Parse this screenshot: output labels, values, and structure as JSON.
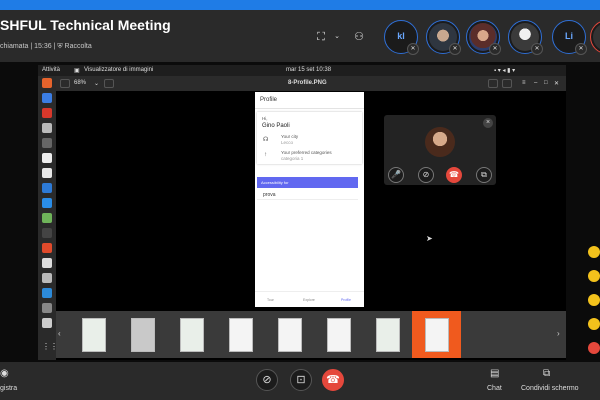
{
  "header": {
    "title": "SHFUL Technical Meeting",
    "subtitle": "chiamata | 15:36 | ⛨ Raccolta",
    "participants": [
      {
        "initials": "kl"
      },
      {
        "initials": ""
      },
      {
        "initials": ""
      },
      {
        "initials": ""
      },
      {
        "initials": "Li"
      }
    ]
  },
  "desktop": {
    "activities": "Attività",
    "app_name": "Visualizzatore di immagini",
    "clock": "mar 15 set  10:38",
    "zoom": "68%",
    "file_name": "8-Profile.PNG"
  },
  "profile_mock": {
    "header": "Profile",
    "hi": "Hi,",
    "name": "Gino Paoli",
    "city_label": "Your city",
    "city_value": "Lecco",
    "cat_label": "Your preferred categories",
    "cat_value": "categoria 1",
    "accessibility": "Accessibility for",
    "prova": "prova",
    "tab_tour": "Tour",
    "tab_explore": "Explore",
    "tab_profile": "Profile"
  },
  "controls": {
    "record_label": "gistra",
    "chat_label": "Chat",
    "share_label": "Condividi schermo"
  },
  "colors": {
    "accent": "#2f6fd6",
    "end_call": "#e5483c",
    "thumb_selected": "#f05a1e"
  }
}
